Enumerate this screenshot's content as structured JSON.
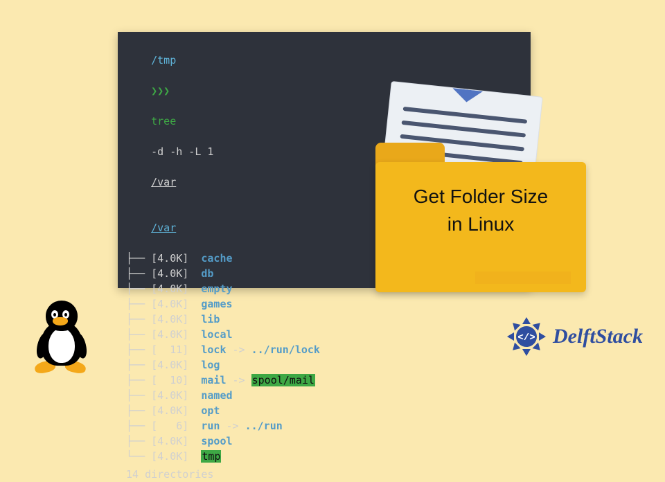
{
  "terminal": {
    "cwd": "/tmp",
    "prompt_angles": "❯❯❯",
    "command": "tree",
    "args": "-d -h -L 1",
    "arg_path": "/var",
    "root": "/var",
    "rows": [
      {
        "branch": "├──",
        "size": "4.0K",
        "name": "cache"
      },
      {
        "branch": "├──",
        "size": "4.0K",
        "name": "db"
      },
      {
        "branch": "├──",
        "size": "4.0K",
        "name": "empty"
      },
      {
        "branch": "├──",
        "size": "4.0K",
        "name": "games"
      },
      {
        "branch": "├──",
        "size": "4.0K",
        "name": "lib"
      },
      {
        "branch": "├──",
        "size": "4.0K",
        "name": "local"
      },
      {
        "branch": "├──",
        "size": "  11",
        "name": "lock",
        "link": "../run/lock",
        "link_hl": false
      },
      {
        "branch": "├──",
        "size": "4.0K",
        "name": "log"
      },
      {
        "branch": "├──",
        "size": "  10",
        "name": "mail",
        "link": "spool/mail",
        "link_hl": true
      },
      {
        "branch": "├──",
        "size": "4.0K",
        "name": "named"
      },
      {
        "branch": "├──",
        "size": "4.0K",
        "name": "opt"
      },
      {
        "branch": "├──",
        "size": "   6",
        "name": "run",
        "link": "../run",
        "link_hl": false
      },
      {
        "branch": "├──",
        "size": "4.0K",
        "name": "spool"
      },
      {
        "branch": "└──",
        "size": "4.0K",
        "name": "tmp",
        "name_hl": true
      }
    ],
    "summary": "14 directories"
  },
  "folder": {
    "line1": "Get Folder Size",
    "line2": "in Linux"
  },
  "brand": {
    "name": "DelftStack"
  }
}
